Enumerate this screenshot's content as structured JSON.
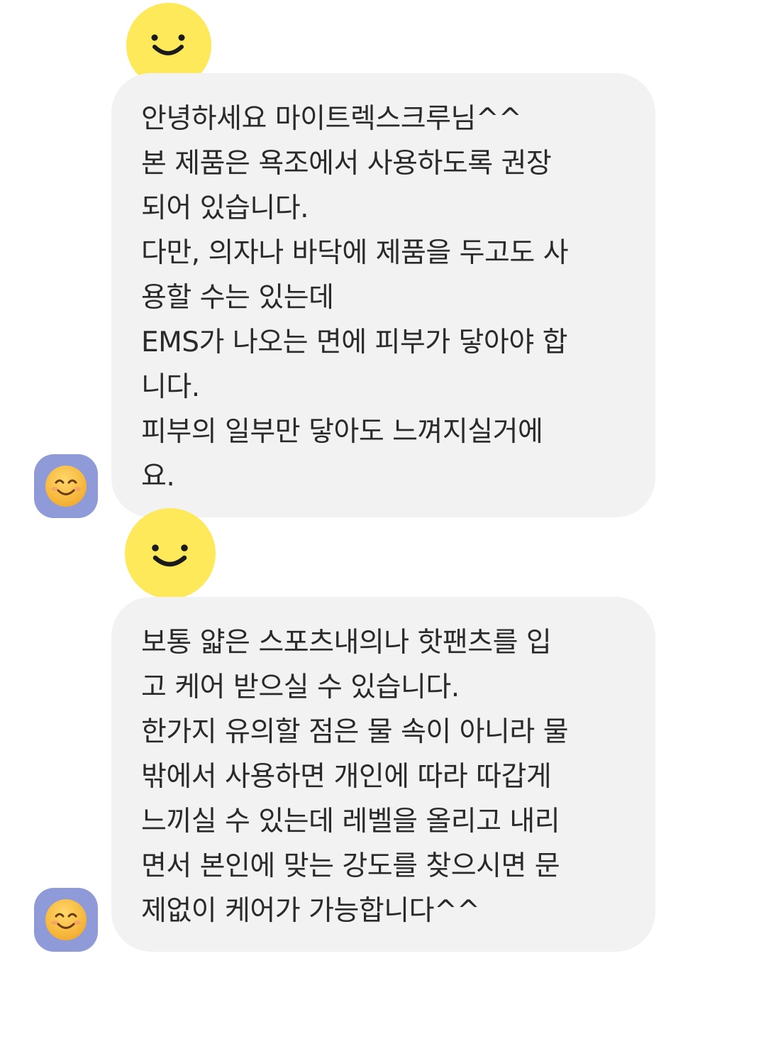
{
  "messages": [
    {
      "avatar_icon": "smiling-face-avatar",
      "sticker_icon": "yellow-smiley-sticker",
      "lines": [
        "안녕하세요 마이트렉스크루님^^",
        "본 제품은 욕조에서 사용하도록 권장",
        "되어 있습니다.",
        "다만, 의자나 바닥에 제품을 두고도 사",
        "용할 수는 있는데",
        "EMS가 나오는 면에 피부가 닿아야 합",
        "니다.",
        "피부의 일부만 닿아도 느껴지실거에",
        "요."
      ]
    },
    {
      "avatar_icon": "smiling-face-avatar",
      "sticker_icon": "yellow-smiley-sticker",
      "lines": [
        "보통 얇은 스포츠내의나 핫팬츠를 입",
        "고 케어 받으실 수 있습니다.",
        "한가지 유의할 점은 물 속이 아니라 물",
        "밖에서 사용하면 개인에 따라 따갑게",
        "느끼실 수 있는데 레벨을 올리고 내리",
        "면서 본인에 맞는 강도를 찾으시면 문",
        "제없이 케어가 가능합니다^^"
      ]
    }
  ],
  "colors": {
    "bubble": "#f2f2f2",
    "sticker": "#fde95a",
    "avatar_bg": "#8f9ad8",
    "text": "#2a2a2a"
  }
}
